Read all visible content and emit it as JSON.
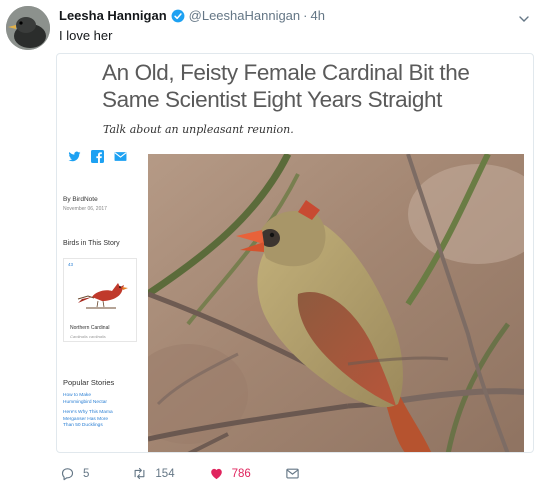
{
  "tweet": {
    "display_name": "Leesha Hannigan",
    "handle": "@LeeshaHannigan",
    "separator": "·",
    "time": "4h",
    "text": "I love her"
  },
  "card": {
    "headline": "An Old, Feisty Female Cardinal Bit the Same Scientist Eight Years Straight",
    "deck": "Talk about an unpleasant reunion.",
    "byline": "By BirdNote",
    "byline_date": "November 06, 2017",
    "birds_heading": "Birds in This Story",
    "bird_number": "43",
    "bird_name": "Northern Cardinal",
    "bird_scientific": "Cardinalis cardinalis",
    "popular_heading": "Popular Stories",
    "popular_items": [
      "How to Make\nHummingbird Nectar",
      "Here's Why This Mama\nMerganser Has More\nThan 50 Ducklings"
    ]
  },
  "actions": {
    "replies": "5",
    "retweets": "154",
    "likes": "786"
  },
  "colors": {
    "twitter_blue": "#1da1f2",
    "like_red": "#e0245e",
    "muted_gray": "#657786",
    "cardinal_red": "#c0392b"
  },
  "icons": [
    "verified-icon",
    "chevron-down-icon",
    "twitter-share-icon",
    "facebook-share-icon",
    "email-share-icon",
    "reply-icon",
    "retweet-icon",
    "like-icon",
    "direct-message-icon"
  ]
}
